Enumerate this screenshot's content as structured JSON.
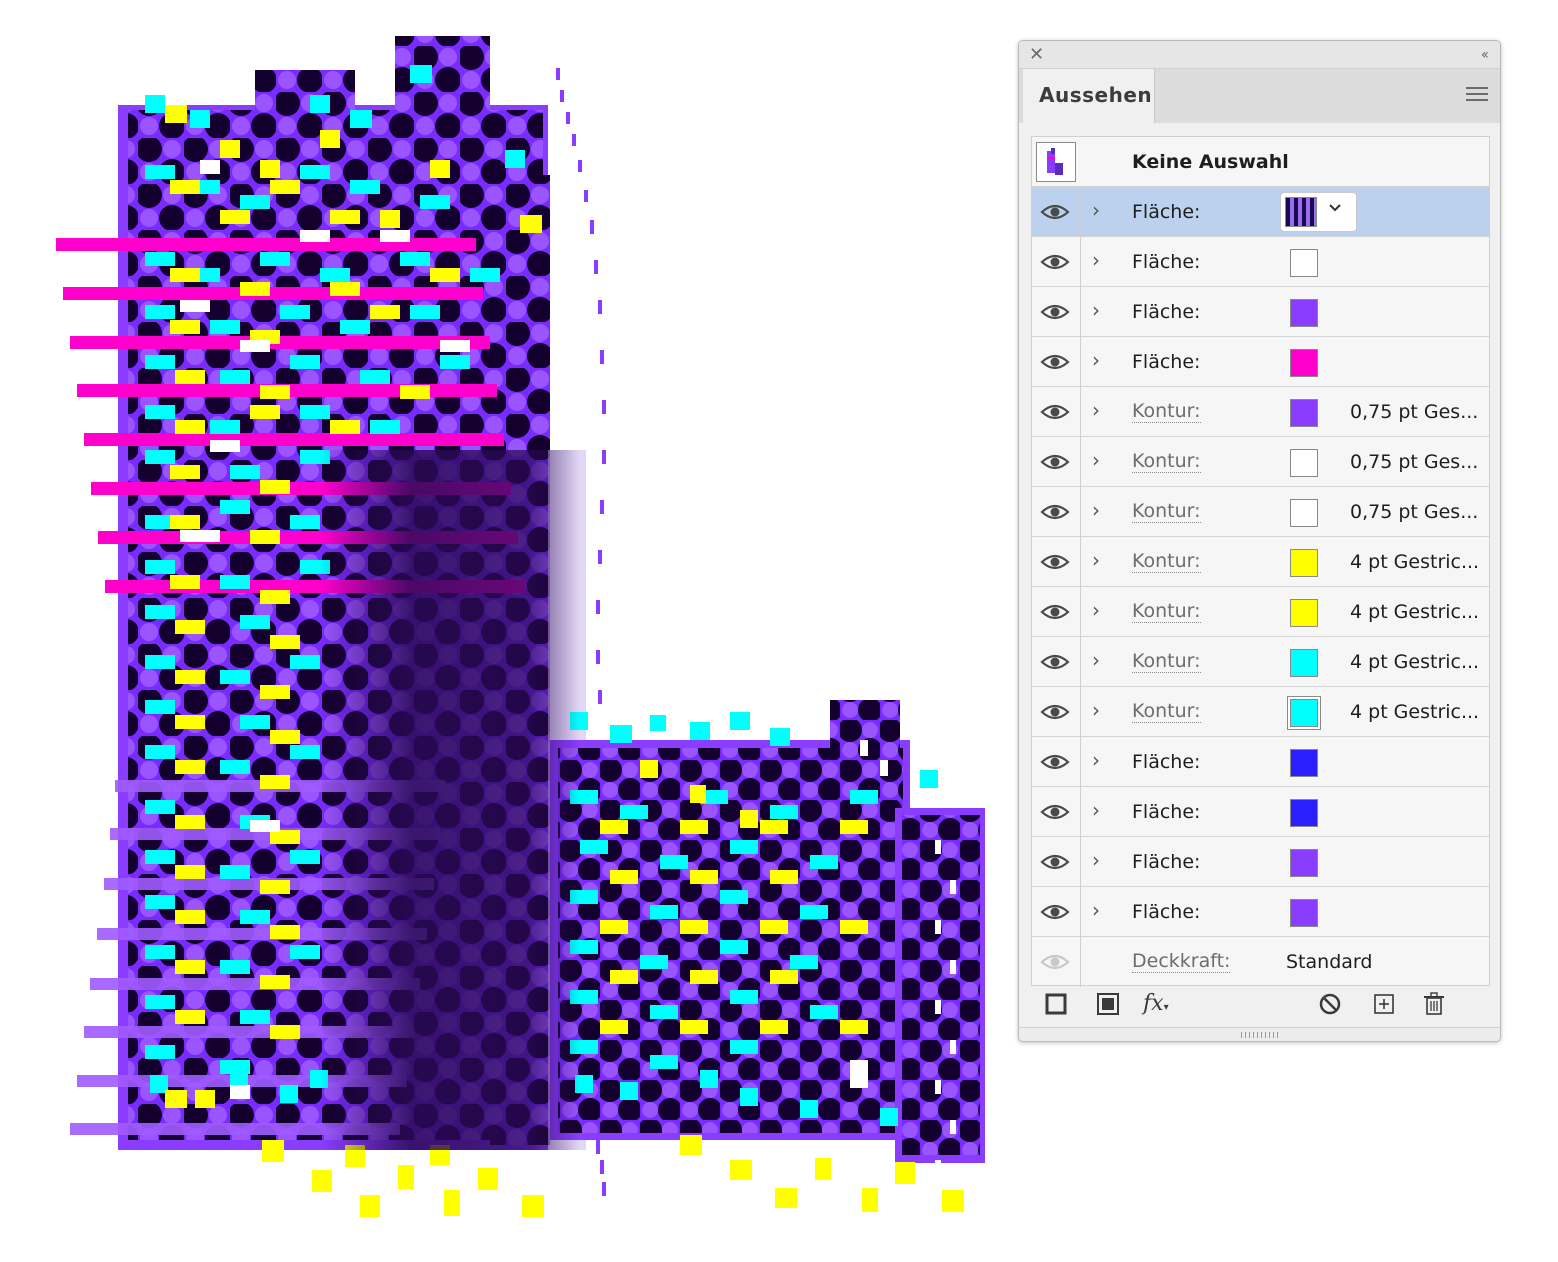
{
  "panel": {
    "tab_label": "Aussehen",
    "header_label": "Keine Auswahl",
    "rows": [
      {
        "label": "Fläche:",
        "kind": "fill",
        "swatch": "gradient",
        "value": "",
        "selected": true
      },
      {
        "label": "Fläche:",
        "kind": "fill",
        "swatch": "#ffffff",
        "value": ""
      },
      {
        "label": "Fläche:",
        "kind": "fill",
        "swatch": "#8a3dff",
        "value": ""
      },
      {
        "label": "Fläche:",
        "kind": "fill",
        "swatch": "#ff00cc",
        "value": ""
      },
      {
        "label": "Kontur:",
        "kind": "stroke",
        "swatch": "#8a3dff",
        "value": "0,75 pt Ges..."
      },
      {
        "label": "Kontur:",
        "kind": "stroke",
        "swatch": "#ffffff",
        "value": "0,75 pt Ges..."
      },
      {
        "label": "Kontur:",
        "kind": "stroke",
        "swatch": "#ffffff",
        "value": "0,75 pt Ges..."
      },
      {
        "label": "Kontur:",
        "kind": "stroke",
        "swatch": "#ffff00",
        "value": "4 pt Gestric..."
      },
      {
        "label": "Kontur:",
        "kind": "stroke",
        "swatch": "#ffff00",
        "value": "4 pt Gestric..."
      },
      {
        "label": "Kontur:",
        "kind": "stroke",
        "swatch": "#00ffff",
        "value": "4 pt Gestric..."
      },
      {
        "label": "Kontur:",
        "kind": "stroke",
        "swatch": "#00ffff",
        "value": "4 pt Gestric...",
        "framed": true
      },
      {
        "label": "Fläche:",
        "kind": "fill",
        "swatch": "#2a1fff",
        "value": ""
      },
      {
        "label": "Fläche:",
        "kind": "fill",
        "swatch": "#2a1fff",
        "value": ""
      },
      {
        "label": "Fläche:",
        "kind": "fill",
        "swatch": "#8a3dff",
        "value": ""
      },
      {
        "label": "Fläche:",
        "kind": "fill",
        "swatch": "#8a3dff",
        "value": ""
      }
    ],
    "opacity_label": "Deckkraft:",
    "opacity_value": "Standard",
    "toolbar": {
      "fx_label": "fx"
    },
    "icons": [
      "close-icon",
      "collapse-icon",
      "menu-icon",
      "eye-icon",
      "chevron-right-icon",
      "chevron-down-icon",
      "add-stroke-icon",
      "add-fill-icon",
      "fx-icon",
      "clear-icon",
      "duplicate-icon",
      "trash-icon"
    ]
  },
  "artwork": {
    "colors": {
      "base": "#8a3dff",
      "dark": "#1a0033",
      "cyan": "#00ffff",
      "yellow": "#ffff00",
      "magenta": "#ff00cc",
      "white": "#ffffff"
    }
  }
}
